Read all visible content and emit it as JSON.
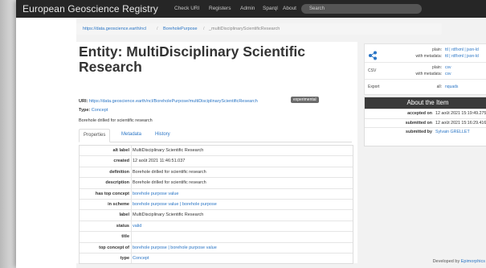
{
  "navbar": {
    "brand": "European Geoscience Registry",
    "links": [
      "Check URI",
      "Registers",
      "Admin",
      "Sparql",
      "About"
    ],
    "search_placeholder": "Search"
  },
  "breadcrumb": {
    "items": [
      "https://data.geoscience.earth/ncl",
      "BoreholePurpose",
      "_multiDisciplinaryScientificResearch"
    ],
    "separator": "/"
  },
  "entity": {
    "title": "Entity: MultiDisciplinary Scientific Research",
    "uri_label": "URI:",
    "uri": "https://data.geoscience.earth/ncl/BoreholePurpose/multiDisciplinaryScientificResearch",
    "status_badge": "experimental",
    "type_label": "Type:",
    "type": "Concept",
    "description": "Borehole drilled for scientific research"
  },
  "tabs": [
    "Properties",
    "Metadata",
    "History"
  ],
  "properties": [
    {
      "key": "alt label",
      "value": "MultiDisciplinary Scientific Research",
      "link": false
    },
    {
      "key": "created",
      "value": "12 août 2021 11:46:51.037",
      "link": false
    },
    {
      "key": "definition",
      "value": "Borehole drilled for scientific research",
      "link": false
    },
    {
      "key": "description",
      "value": "Borehole drilled for scientific research",
      "link": false
    },
    {
      "key": "has top concept",
      "value": "borehole purpose value",
      "link": true
    },
    {
      "key": "in scheme",
      "value": "borehole purpose value | borehole purpose",
      "link": true
    },
    {
      "key": "label",
      "value": "MultiDisciplinary Scientific Research",
      "link": false
    },
    {
      "key": "status",
      "value": "valid",
      "link": true
    },
    {
      "key": "title",
      "value": "",
      "link": false
    },
    {
      "key": "top concept of",
      "value": "borehole purpose | borehole purpose value",
      "link": true
    },
    {
      "key": "type",
      "value": "Concept",
      "link": true
    }
  ],
  "formats": {
    "rdf": {
      "plain_label": "plain:",
      "plain_value": "ttl | rdf/xml | json-ld",
      "meta_label": "with metadata:",
      "meta_value": "ttl | rdf/xml | json-ld"
    },
    "csv": {
      "label": "CSV",
      "plain_label": "plain:",
      "plain_value": "csv",
      "meta_label": "with metadata:",
      "meta_value": "csv"
    },
    "export": {
      "label": "Export",
      "all_label": "all:",
      "all_value": "nquads"
    }
  },
  "about": {
    "heading": "About the Item",
    "accepted_label": "accepted on",
    "accepted_value": "12 août 2021 15:19:49.275",
    "submitted_label": "submitted on",
    "submitted_value": "12 août 2021 15:16:29.416",
    "by_label": "submitted by",
    "by_value": "Sylvain GRELLET"
  },
  "footer": {
    "text": "Developed by",
    "link": "Epimorphics"
  },
  "colors": {
    "navbar": "#262626",
    "link": "#2a75c5",
    "badge": "#6b6b6b",
    "about_header": "#3a3a3a"
  }
}
